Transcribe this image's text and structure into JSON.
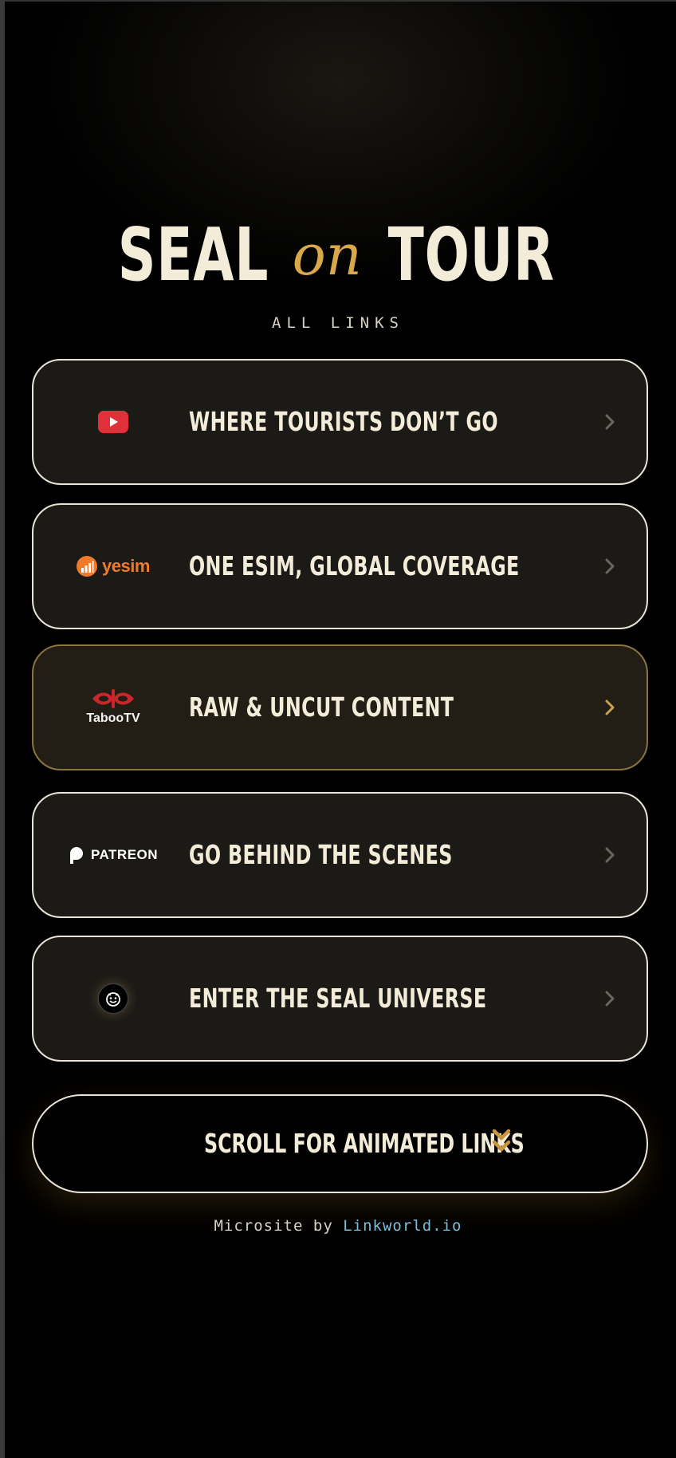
{
  "header": {
    "title_part1": "SEAL",
    "title_part2": "on",
    "title_part3": "TOUR",
    "subtitle": "ALL LINKS"
  },
  "links": [
    {
      "label": "WHERE TOURISTS DON’T GO",
      "icon": "youtube-icon",
      "featured": false
    },
    {
      "label": "ONE ESIM, GLOBAL COVERAGE",
      "icon": "yesim-logo",
      "logo_text": "yesim",
      "featured": false
    },
    {
      "label": "RAW & UNCUT CONTENT",
      "icon": "taboo-tv-logo",
      "logo_text": "TabooTV",
      "featured": true
    },
    {
      "label": "GO BEHIND THE SCENES",
      "icon": "patreon-logo",
      "logo_text": "PATREON",
      "featured": false
    },
    {
      "label": "ENTER THE SEAL UNIVERSE",
      "icon": "seal-face-icon",
      "featured": false
    }
  ],
  "scroll_button": {
    "label": "SCROLL FOR ANIMATED LINKS",
    "icon": "double-chevron-down-icon"
  },
  "footer": {
    "prefix": "Microsite by",
    "link_text": "Linkworld.io"
  },
  "colors": {
    "background": "#000000",
    "card": "#1c1a16",
    "card_border": "#e9e4d8",
    "featured_border": "#8a7440",
    "text": "#f3ecd9",
    "accent_gold": "#d9a84a",
    "link_blue": "#7fbcd8",
    "youtube_red": "#e0303a",
    "yesim_orange": "#f07a2a",
    "taboo_red": "#c8262c"
  }
}
